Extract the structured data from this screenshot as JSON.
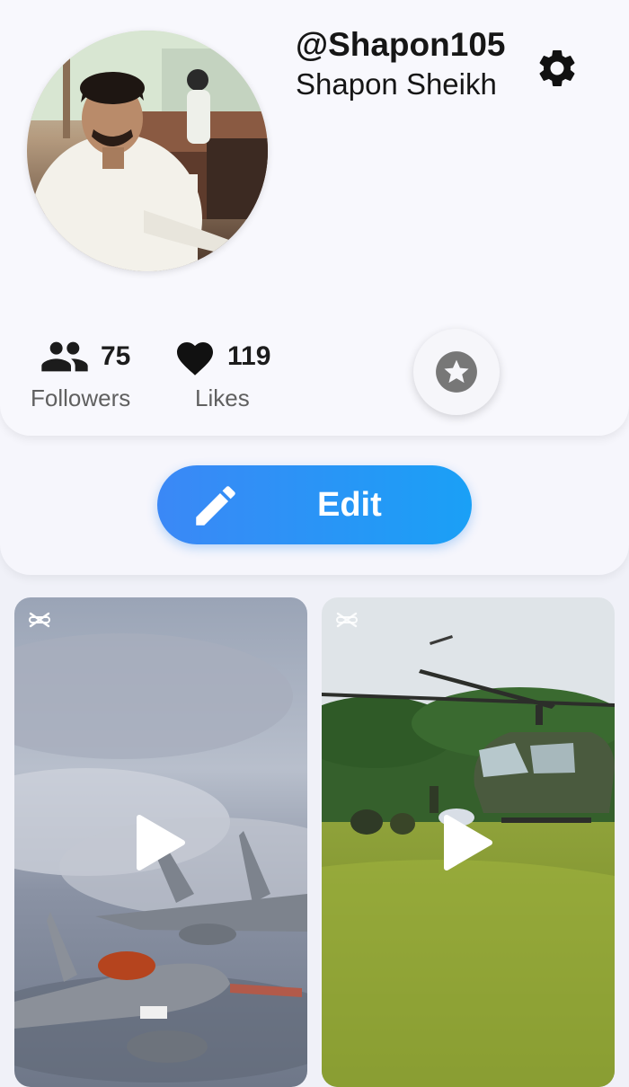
{
  "profile": {
    "username": "@Shapon105",
    "full_name": "Shapon Sheikh"
  },
  "stats": {
    "followers_count": "75",
    "followers_label": "Followers",
    "likes_count": "119",
    "likes_label": "Likes"
  },
  "actions": {
    "edit_label": "Edit"
  },
  "icons": {
    "settings": "gear-icon",
    "followers": "people-icon",
    "likes": "heart-icon",
    "favorite": "star-icon",
    "edit": "pencil-icon",
    "video_badge": "capcut-icon",
    "play": "play-icon"
  },
  "colors": {
    "accent_start": "#3b88f6",
    "accent_end": "#1aa0f6",
    "text_primary": "#161616",
    "text_secondary": "#606060"
  }
}
